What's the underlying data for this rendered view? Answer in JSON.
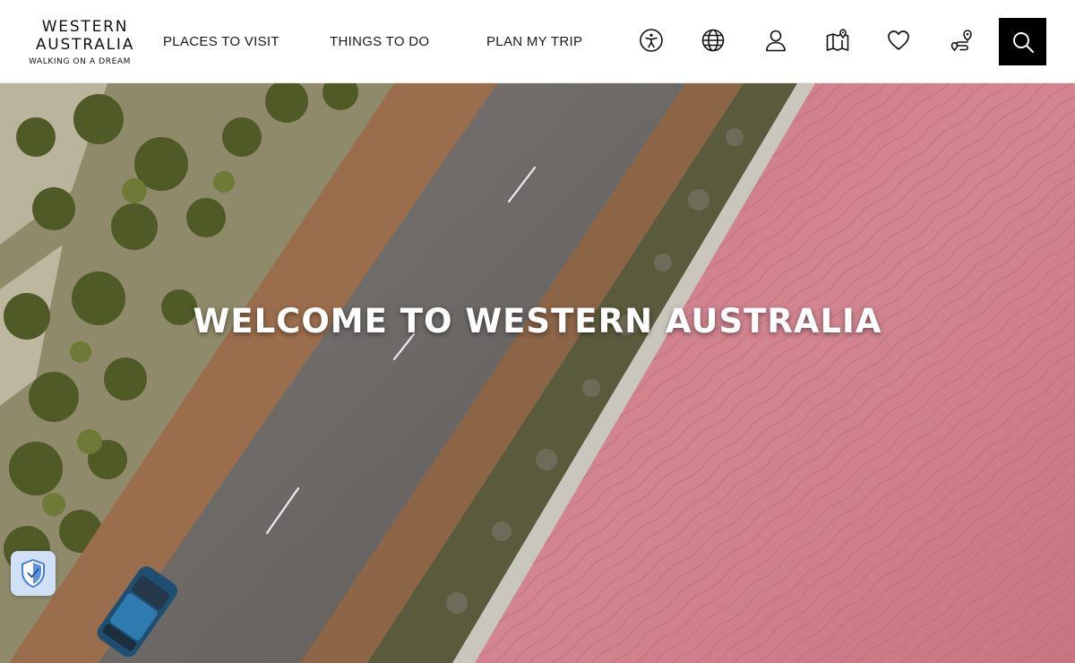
{
  "logo": {
    "line1": "WESTERN",
    "line2": "AUSTRALIA",
    "tagline": "WALKING ON A DREAM"
  },
  "nav": [
    {
      "label": "PLACES TO VISIT"
    },
    {
      "label": "THINGS TO DO"
    },
    {
      "label": "PLAN MY TRIP"
    }
  ],
  "header_icons": [
    "accessibility-icon",
    "globe-icon",
    "user-icon",
    "map-icon",
    "heart-icon",
    "route-icon"
  ],
  "search": {
    "icon": "search-icon"
  },
  "hero": {
    "title": "WELCOME TO WESTERN AUSTRALIA"
  },
  "security_badge": {
    "icon": "shield-check-icon"
  },
  "colors": {
    "header_bg": "#ffffff",
    "text": "#1a1a1a",
    "search_bg": "#000000",
    "lake_pink": "#cf7f8a",
    "road_grey": "#6d6a67",
    "dirt_brown": "#9a6d4c",
    "scrub_green": "#5f6a33",
    "badge_bg": "#cfe0f7",
    "badge_shield": "#3f7fe0"
  }
}
